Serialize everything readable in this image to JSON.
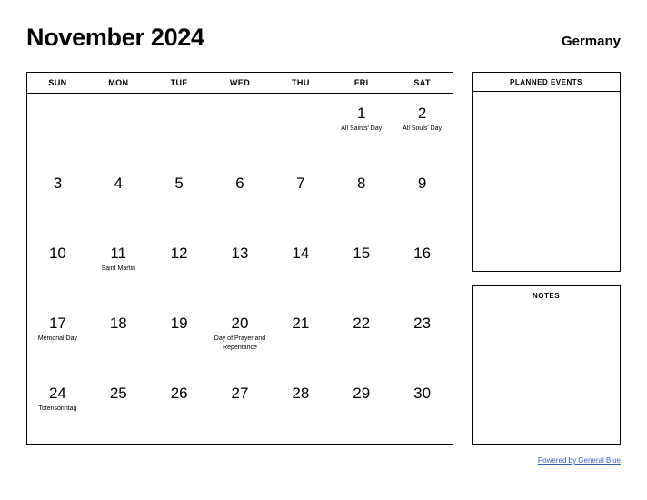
{
  "header": {
    "title": "November 2024",
    "region": "Germany"
  },
  "calendar": {
    "weekdays": [
      "SUN",
      "MON",
      "TUE",
      "WED",
      "THU",
      "FRI",
      "SAT"
    ],
    "weeks": [
      [
        {
          "day": "",
          "event": ""
        },
        {
          "day": "",
          "event": ""
        },
        {
          "day": "",
          "event": ""
        },
        {
          "day": "",
          "event": ""
        },
        {
          "day": "",
          "event": ""
        },
        {
          "day": "1",
          "event": "All Saints' Day"
        },
        {
          "day": "2",
          "event": "All Souls' Day"
        }
      ],
      [
        {
          "day": "3",
          "event": ""
        },
        {
          "day": "4",
          "event": ""
        },
        {
          "day": "5",
          "event": ""
        },
        {
          "day": "6",
          "event": ""
        },
        {
          "day": "7",
          "event": ""
        },
        {
          "day": "8",
          "event": ""
        },
        {
          "day": "9",
          "event": ""
        }
      ],
      [
        {
          "day": "10",
          "event": ""
        },
        {
          "day": "11",
          "event": "Saint Martin"
        },
        {
          "day": "12",
          "event": ""
        },
        {
          "day": "13",
          "event": ""
        },
        {
          "day": "14",
          "event": ""
        },
        {
          "day": "15",
          "event": ""
        },
        {
          "day": "16",
          "event": ""
        }
      ],
      [
        {
          "day": "17",
          "event": "Memorial Day"
        },
        {
          "day": "18",
          "event": ""
        },
        {
          "day": "19",
          "event": ""
        },
        {
          "day": "20",
          "event": "Day of Prayer and Repentance"
        },
        {
          "day": "21",
          "event": ""
        },
        {
          "day": "22",
          "event": ""
        },
        {
          "day": "23",
          "event": ""
        }
      ],
      [
        {
          "day": "24",
          "event": "Totensonntag"
        },
        {
          "day": "25",
          "event": ""
        },
        {
          "day": "26",
          "event": ""
        },
        {
          "day": "27",
          "event": ""
        },
        {
          "day": "28",
          "event": ""
        },
        {
          "day": "29",
          "event": ""
        },
        {
          "day": "30",
          "event": ""
        }
      ]
    ]
  },
  "panels": {
    "events": {
      "title": "PLANNED EVENTS",
      "content": ""
    },
    "notes": {
      "title": "NOTES",
      "content": ""
    }
  },
  "footer": {
    "link_label": "Powered by General Blue",
    "link_color": "#3b5ebd"
  }
}
